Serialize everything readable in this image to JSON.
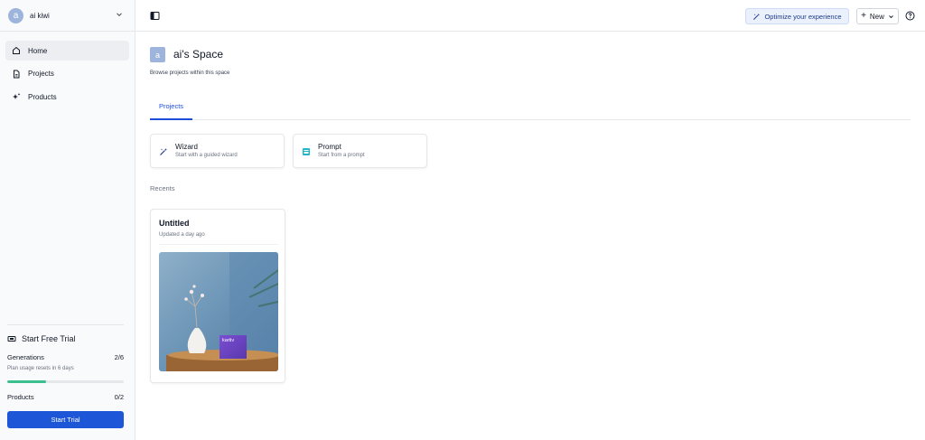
{
  "workspace": {
    "avatar_letter": "a",
    "name": "ai kiwi"
  },
  "nav": {
    "items": [
      {
        "label": "Home",
        "icon": "home-icon",
        "active": true
      },
      {
        "label": "Projects",
        "icon": "file-icon",
        "active": false
      },
      {
        "label": "Products",
        "icon": "sparkle-icon",
        "active": false
      }
    ]
  },
  "trial": {
    "title": "Start Free Trial",
    "generations_label": "Generations",
    "generations_count": "2/6",
    "reset_text": "Plan usage resets in 6 days",
    "generations_progress": 0.33,
    "products_label": "Products",
    "products_count": "0/2",
    "button_label": "Start Trial"
  },
  "topbar": {
    "optimize_label": "Optimize your experience",
    "new_label": "New"
  },
  "space": {
    "avatar_letter": "a",
    "title": "ai's Space",
    "subtitle": "Browse projects within this space"
  },
  "tabs": [
    {
      "label": "Projects",
      "active": true
    }
  ],
  "create_options": [
    {
      "title": "Wizard",
      "subtitle": "Start with a guided wizard",
      "icon": "wand-icon"
    },
    {
      "title": "Prompt",
      "subtitle": "Start from a prompt",
      "icon": "prompt-icon"
    }
  ],
  "recents_label": "Recents",
  "projects": [
    {
      "title": "Untitled",
      "updated": "Updated a day ago",
      "thumbnail_text": "kartiv"
    }
  ],
  "colors": {
    "accent": "#1d57d8",
    "progress": "#3cbf8f",
    "avatar": "#9db4dc"
  }
}
